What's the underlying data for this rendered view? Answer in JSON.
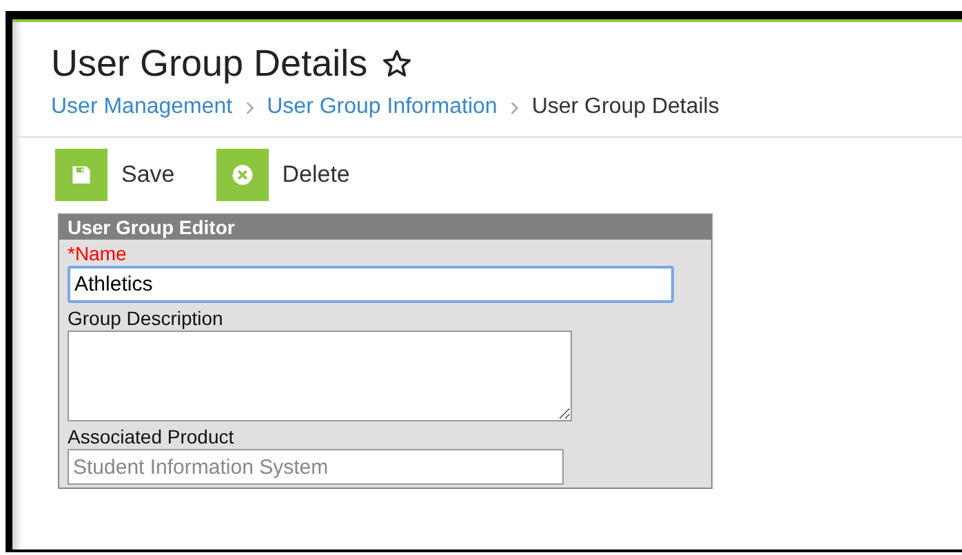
{
  "page": {
    "title": "User Group Details",
    "favorite": false
  },
  "breadcrumb": [
    {
      "label": "User Management",
      "link": true
    },
    {
      "label": "User Group Information",
      "link": true
    },
    {
      "label": "User Group Details",
      "link": false
    }
  ],
  "toolbar": [
    {
      "kind": "save",
      "label": "Save"
    },
    {
      "kind": "delete",
      "label": "Delete"
    }
  ],
  "editor": {
    "title": "User Group Editor",
    "fields": [
      {
        "kind": "text",
        "label": "*Name",
        "required": true,
        "value": "Athletics",
        "focused": true
      },
      {
        "kind": "textarea",
        "label": "Group Description",
        "required": false,
        "focused": false
      },
      {
        "kind": "readonly",
        "label": "Associated Product",
        "required": false,
        "value": "Student Information System",
        "focused": false
      }
    ]
  }
}
